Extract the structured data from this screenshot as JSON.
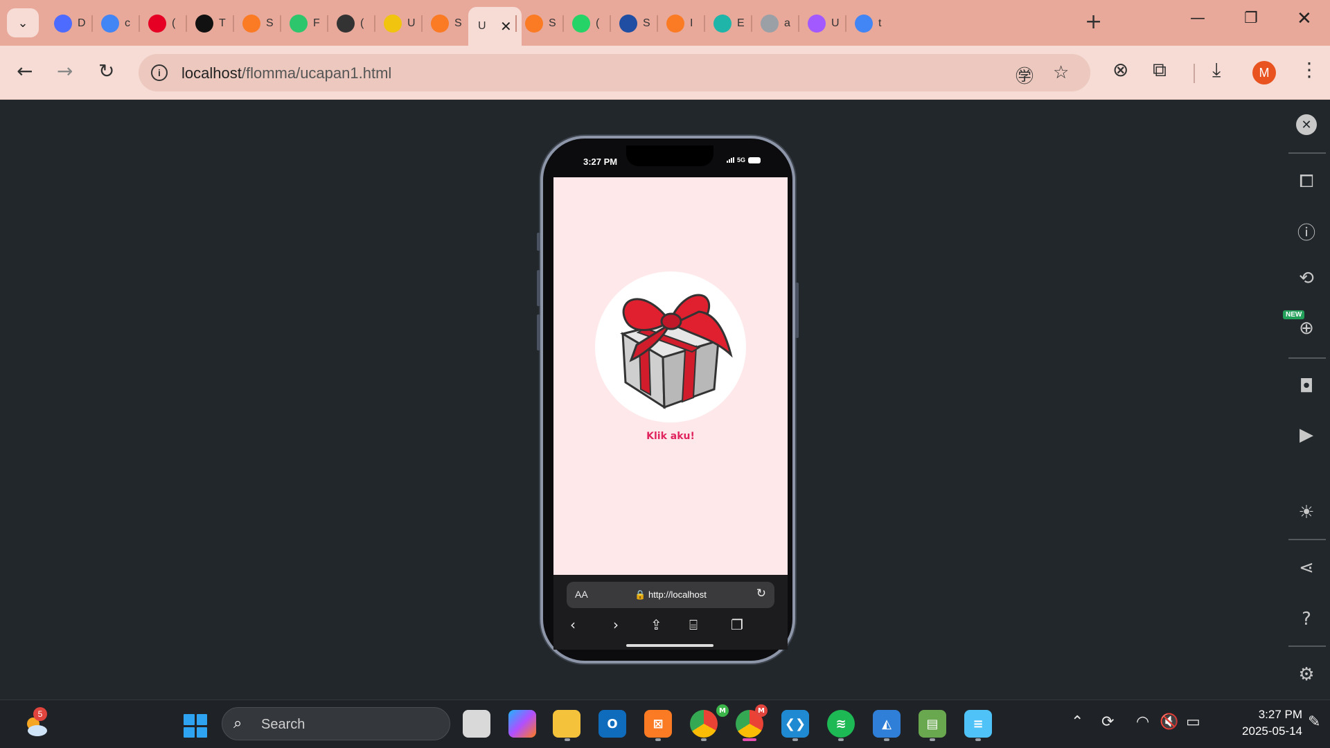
{
  "browser": {
    "tabs": [
      {
        "label": "D",
        "icon": "deepseek-icon",
        "color": "#4d6bfe"
      },
      {
        "label": "c",
        "icon": "google-icon",
        "color": "#4285f4"
      },
      {
        "label": "(",
        "icon": "pinterest-icon",
        "color": "#e60023"
      },
      {
        "label": "T",
        "icon": "film-icon",
        "color": "#111111"
      },
      {
        "label": "S",
        "icon": "xampp-icon",
        "color": "#fb7a24"
      },
      {
        "label": "F",
        "icon": "pixabay-icon",
        "color": "#2ec66d"
      },
      {
        "label": "(",
        "icon": "chatgpt-icon",
        "color": "#333333"
      },
      {
        "label": "U",
        "icon": "course-icon",
        "color": "#f1c40f"
      },
      {
        "label": "S",
        "icon": "xampp-icon",
        "color": "#fb7a24"
      },
      {
        "label": "U",
        "icon": "page-icon",
        "color": "#888888",
        "active": true
      },
      {
        "label": "S",
        "icon": "xampp-icon",
        "color": "#fb7a24"
      },
      {
        "label": "(",
        "icon": "whatsapp-icon",
        "color": "#25d366"
      },
      {
        "label": "S",
        "icon": "tab-icon",
        "color": "#1f4ea3"
      },
      {
        "label": "I",
        "icon": "xampp-icon",
        "color": "#fb7a24"
      },
      {
        "label": "E",
        "icon": "diamond-icon",
        "color": "#1fb5a8"
      },
      {
        "label": "a",
        "icon": "globe-icon",
        "color": "#9aa0a6"
      },
      {
        "label": "U",
        "icon": "figma-icon",
        "color": "#a259ff"
      },
      {
        "label": "t",
        "icon": "google-icon",
        "color": "#4285f4"
      }
    ],
    "url_host": "localhost",
    "url_path": "/flomma/ucapan1.html",
    "profile_initial": "M"
  },
  "phone": {
    "status_time": "3:27 PM",
    "network": "5G",
    "page": {
      "button_label": "Klik aku!",
      "background": "#ffe8ea",
      "accent": "#e0245e"
    },
    "safari": {
      "aa_label": "AA",
      "url": "http://localhost"
    }
  },
  "devtools_rail": {
    "badge_new": "NEW"
  },
  "taskbar": {
    "search_placeholder": "Search",
    "weather_badge": "5",
    "chrome_badge_1": "M",
    "chrome_badge_2": "M",
    "clock_time": "3:27 PM",
    "clock_date": "2025-05-14"
  }
}
